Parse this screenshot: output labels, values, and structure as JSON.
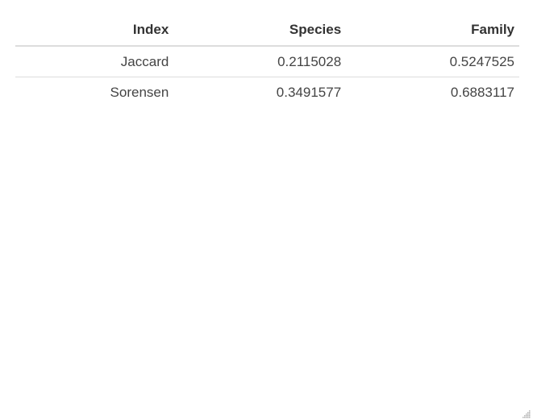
{
  "table": {
    "columns": [
      "Index",
      "Species",
      "Family"
    ],
    "rows": [
      {
        "index": "Jaccard",
        "species": "0.2115028",
        "family": "0.5247525"
      },
      {
        "index": "Sorensen",
        "species": "0.3491577",
        "family": "0.6883117"
      }
    ]
  },
  "icons": {
    "resize": "resize-grip-icon"
  }
}
